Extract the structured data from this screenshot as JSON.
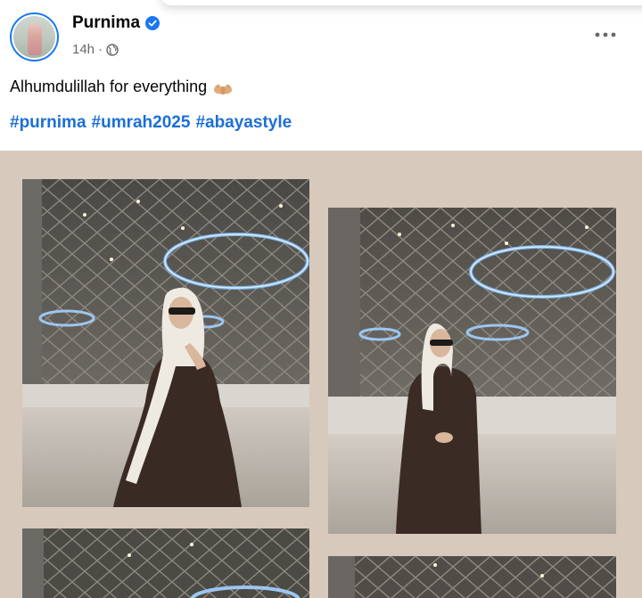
{
  "post": {
    "author": "Purnima",
    "time": "14h",
    "separator": "·",
    "privacy_icon": "globe-icon",
    "verified_icon": "verified-badge-icon",
    "more_icon": "more-options-icon",
    "caption": "Alhumdulillah for everything",
    "caption_emoji_icon": "praying-hands-emoji",
    "hashtags": [
      "#purnima",
      "#umrah2025",
      "#abayastyle"
    ]
  },
  "colors": {
    "link": "#1b6fd6",
    "gallery_bg": "#d7c9bc",
    "verified": "#1877f2"
  },
  "photos": [
    {
      "icon": "photo-woman-abaya-hand-raised"
    },
    {
      "icon": "photo-woman-abaya-standing"
    },
    {
      "icon": "photo-mosque-ceiling-partial"
    },
    {
      "icon": "photo-mosque-ceiling-partial"
    }
  ]
}
